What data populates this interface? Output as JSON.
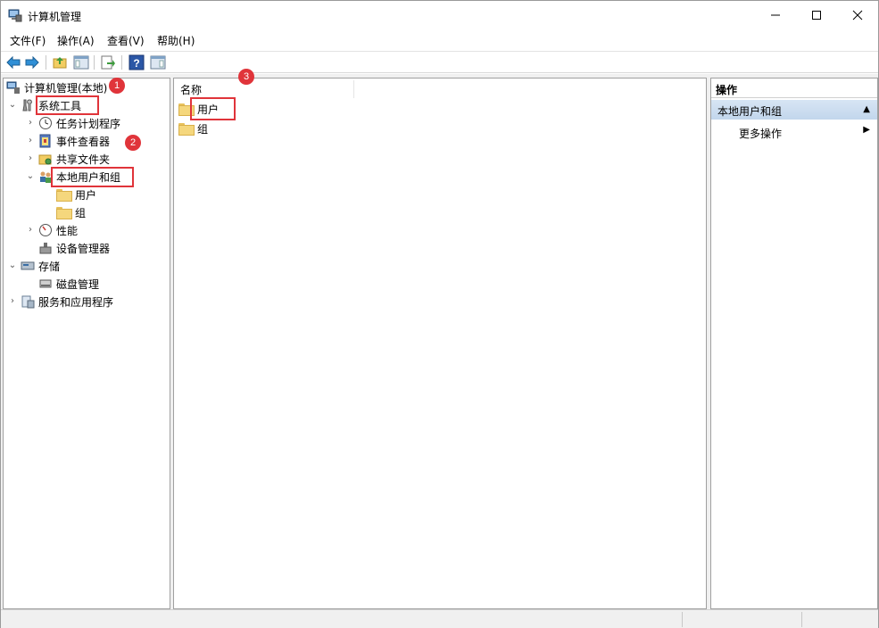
{
  "window": {
    "title": "计算机管理",
    "minimize_glyph": "—",
    "maximize_glyph": "☐",
    "close_glyph": "✕"
  },
  "menu": {
    "items": [
      "文件(F)",
      "操作(A)",
      "查看(V)",
      "帮助(H)"
    ]
  },
  "toolbar": {
    "icons": [
      "back-arrow-icon",
      "forward-arrow-icon",
      "up-folder-icon",
      "show-tree-icon",
      "export-list-icon",
      "help-icon",
      "show-action-pane-icon"
    ]
  },
  "tree": {
    "root": "计算机管理(本地)",
    "system_tools": "系统工具",
    "task_scheduler": "任务计划程序",
    "event_viewer": "事件查看器",
    "shared_folders": "共享文件夹",
    "local_users_groups": "本地用户和组",
    "users": "用户",
    "groups": "组",
    "performance": "性能",
    "device_manager": "设备管理器",
    "storage": "存储",
    "disk_management": "磁盘管理",
    "services_apps": "服务和应用程序"
  },
  "list": {
    "column_name": "名称",
    "rows": [
      "用户",
      "组"
    ]
  },
  "actions": {
    "title": "操作",
    "section": "本地用户和组",
    "more": "更多操作"
  },
  "annotations": {
    "badge1": "1",
    "badge2": "2",
    "badge3": "3"
  },
  "colors": {
    "annotation_red": "#e0343a",
    "selection_blue": "#c2d6ec"
  }
}
